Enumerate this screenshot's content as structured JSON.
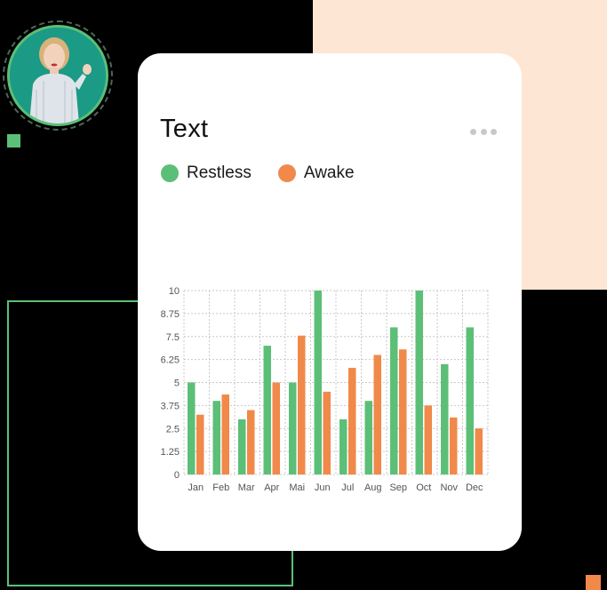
{
  "card": {
    "title": "Text"
  },
  "colors": {
    "restless": "#5cbf77",
    "awake": "#f0894a",
    "peach": "#fde6d4"
  },
  "icons": {
    "more": "more-horizontal-icon"
  },
  "chart_data": {
    "type": "bar",
    "title": "Text",
    "categories": [
      "Jan",
      "Feb",
      "Mar",
      "Apr",
      "Mai",
      "Jun",
      "Jul",
      "Aug",
      "Sep",
      "Oct",
      "Nov",
      "Dec"
    ],
    "series": [
      {
        "name": "Restless",
        "color": "#5cbf77",
        "values": [
          5,
          4,
          3,
          7,
          5,
          10,
          3,
          4,
          8,
          10,
          6,
          8
        ]
      },
      {
        "name": "Awake",
        "color": "#f0894a",
        "values": [
          3.25,
          4.35,
          3.5,
          5,
          7.55,
          4.5,
          5.8,
          6.5,
          6.8,
          3.75,
          3.1,
          2.5
        ]
      }
    ],
    "ylim": [
      0,
      10
    ],
    "yticks": [
      "10",
      "8.75",
      "7.5",
      "6.25",
      "5",
      "3.75",
      "2.5",
      "1.25",
      "0"
    ],
    "grid": true,
    "legend": "top-left"
  }
}
